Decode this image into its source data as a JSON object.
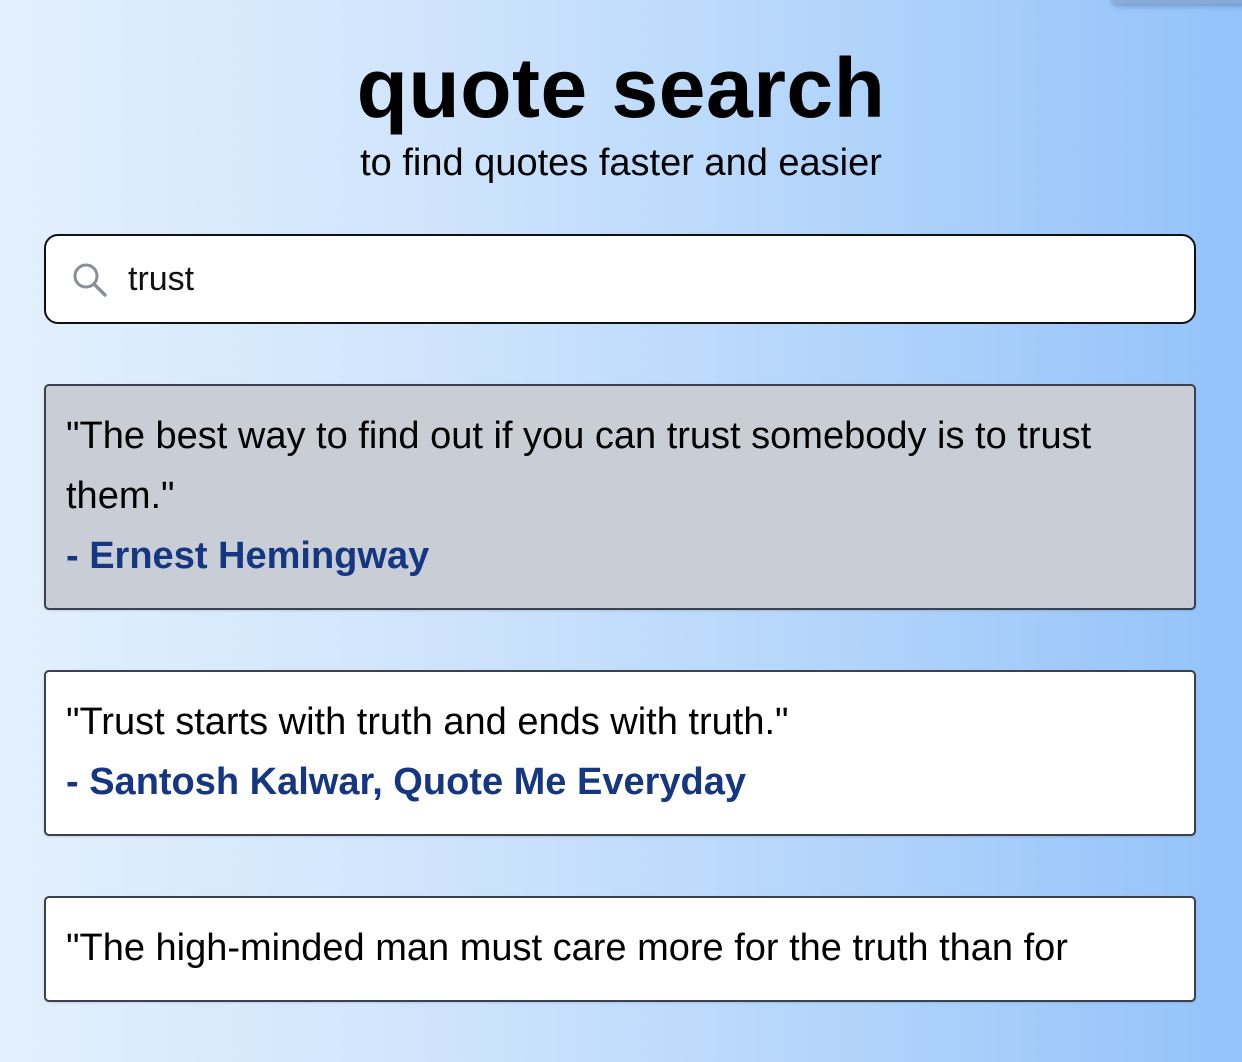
{
  "header": {
    "title": "quote search",
    "subtitle": "to find quotes faster and easier"
  },
  "search": {
    "value": "trust",
    "icon": "search-icon"
  },
  "results": [
    {
      "text": "\"The best way to find out if you can trust somebody is to trust them.\"",
      "author": "- Ernest Hemingway",
      "selected": true
    },
    {
      "text": "\"Trust starts with truth and ends with truth.\"",
      "author": "- Santosh Kalwar, Quote Me Everyday",
      "selected": false
    },
    {
      "text": "\"The high-minded man must care more for the truth than for",
      "author": "",
      "selected": false
    }
  ],
  "colors": {
    "author": "#143683",
    "selected_card": "#c9ced6",
    "card": "#ffffff",
    "background_start": "#e3f0fd",
    "background_end": "#93c3fa"
  }
}
